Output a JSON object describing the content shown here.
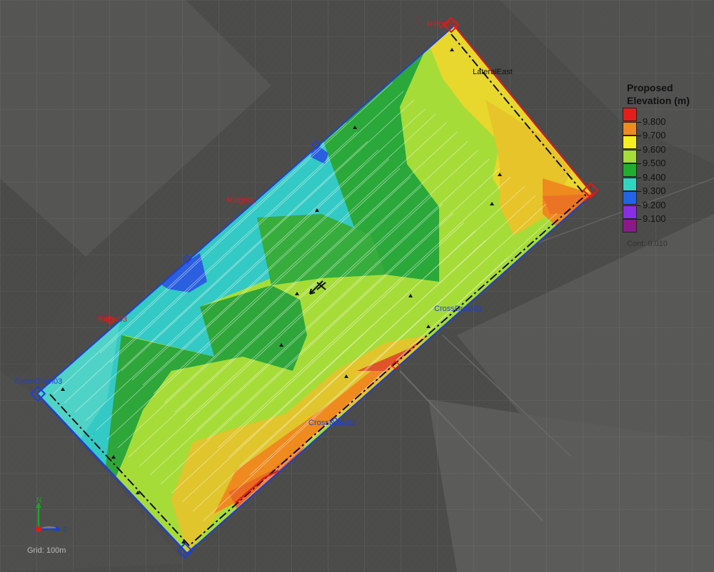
{
  "legend": {
    "title": "Proposed Elevation (m)",
    "entries": [
      {
        "value": "9.800",
        "color": "#e81c1c"
      },
      {
        "value": "9.700",
        "color": "#ef8a1f"
      },
      {
        "value": "9.600",
        "color": "#f4f01c"
      },
      {
        "value": "9.500",
        "color": "#a6dc38"
      },
      {
        "value": "9.400",
        "color": "#1fae2e"
      },
      {
        "value": "9.300",
        "color": "#2fd6bf"
      },
      {
        "value": "9.200",
        "color": "#2364e6"
      },
      {
        "value": "9.100",
        "color": "#8a2ee6"
      },
      {
        "value": "",
        "color": "#8a1a8a"
      }
    ],
    "contour_note": "Cont: 0.010"
  },
  "labels": {
    "ridge_top": "Ridge01",
    "lateral_east": "LateralEast",
    "ridge_mid": "Ridge02",
    "ridge_low": "Ridge03",
    "crossdrain01": "CrossDrain01",
    "crossdrain02": "CrossDrain02",
    "crossdrain03": "CrossDrain03"
  },
  "compass": {
    "north": "N",
    "east": "E"
  },
  "grid_note": "Grid: 100m",
  "colors": {
    "field_high": "#e81c1c",
    "field_mid": "#f4f01c",
    "field_green": "#1fae2e",
    "field_cyan": "#2fd6bf",
    "field_blue": "#2364e6",
    "boundary_black": "#111111",
    "boundary_red": "#e01a1a",
    "boundary_blue": "#1f3fd6"
  }
}
